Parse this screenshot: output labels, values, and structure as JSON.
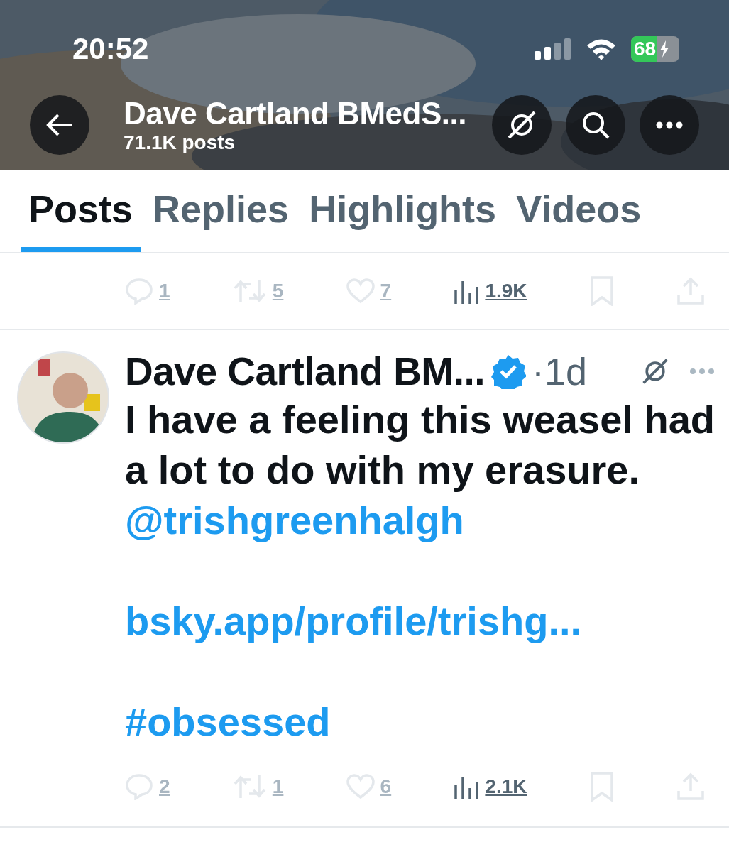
{
  "status_bar": {
    "time": "20:52",
    "battery": "68"
  },
  "header": {
    "title": "Dave Cartland BMedS...",
    "subtitle": "71.1K posts"
  },
  "tabs": [
    {
      "label": "Posts",
      "selected": true
    },
    {
      "label": "Replies",
      "selected": false
    },
    {
      "label": "Highlights",
      "selected": false
    },
    {
      "label": "Videos",
      "selected": false
    }
  ],
  "prev_actions": [
    {
      "kind": "reply",
      "count": "1"
    },
    {
      "kind": "repost",
      "count": "5"
    },
    {
      "kind": "like",
      "count": "7"
    },
    {
      "kind": "views",
      "count": "1.9K"
    },
    {
      "kind": "bookmark"
    },
    {
      "kind": "share"
    }
  ],
  "post": {
    "author": "Dave Cartland BM...",
    "verified": true,
    "time": "·1d",
    "body": [
      {
        "kind": "text",
        "text": "I have a feeling this weasel had a lot to do with my erasure."
      },
      {
        "kind": "mention",
        "text": "@trishgreenhalgh"
      },
      {
        "kind": "link",
        "text": "bsky.app/profile/trishg..."
      },
      {
        "kind": "hashtag",
        "text": "#obsessed"
      }
    ],
    "actions": [
      {
        "kind": "reply",
        "count": "2"
      },
      {
        "kind": "repost",
        "count": "1"
      },
      {
        "kind": "like",
        "count": "6"
      },
      {
        "kind": "views",
        "count": "2.1K"
      },
      {
        "kind": "bookmark"
      },
      {
        "kind": "share"
      }
    ]
  }
}
